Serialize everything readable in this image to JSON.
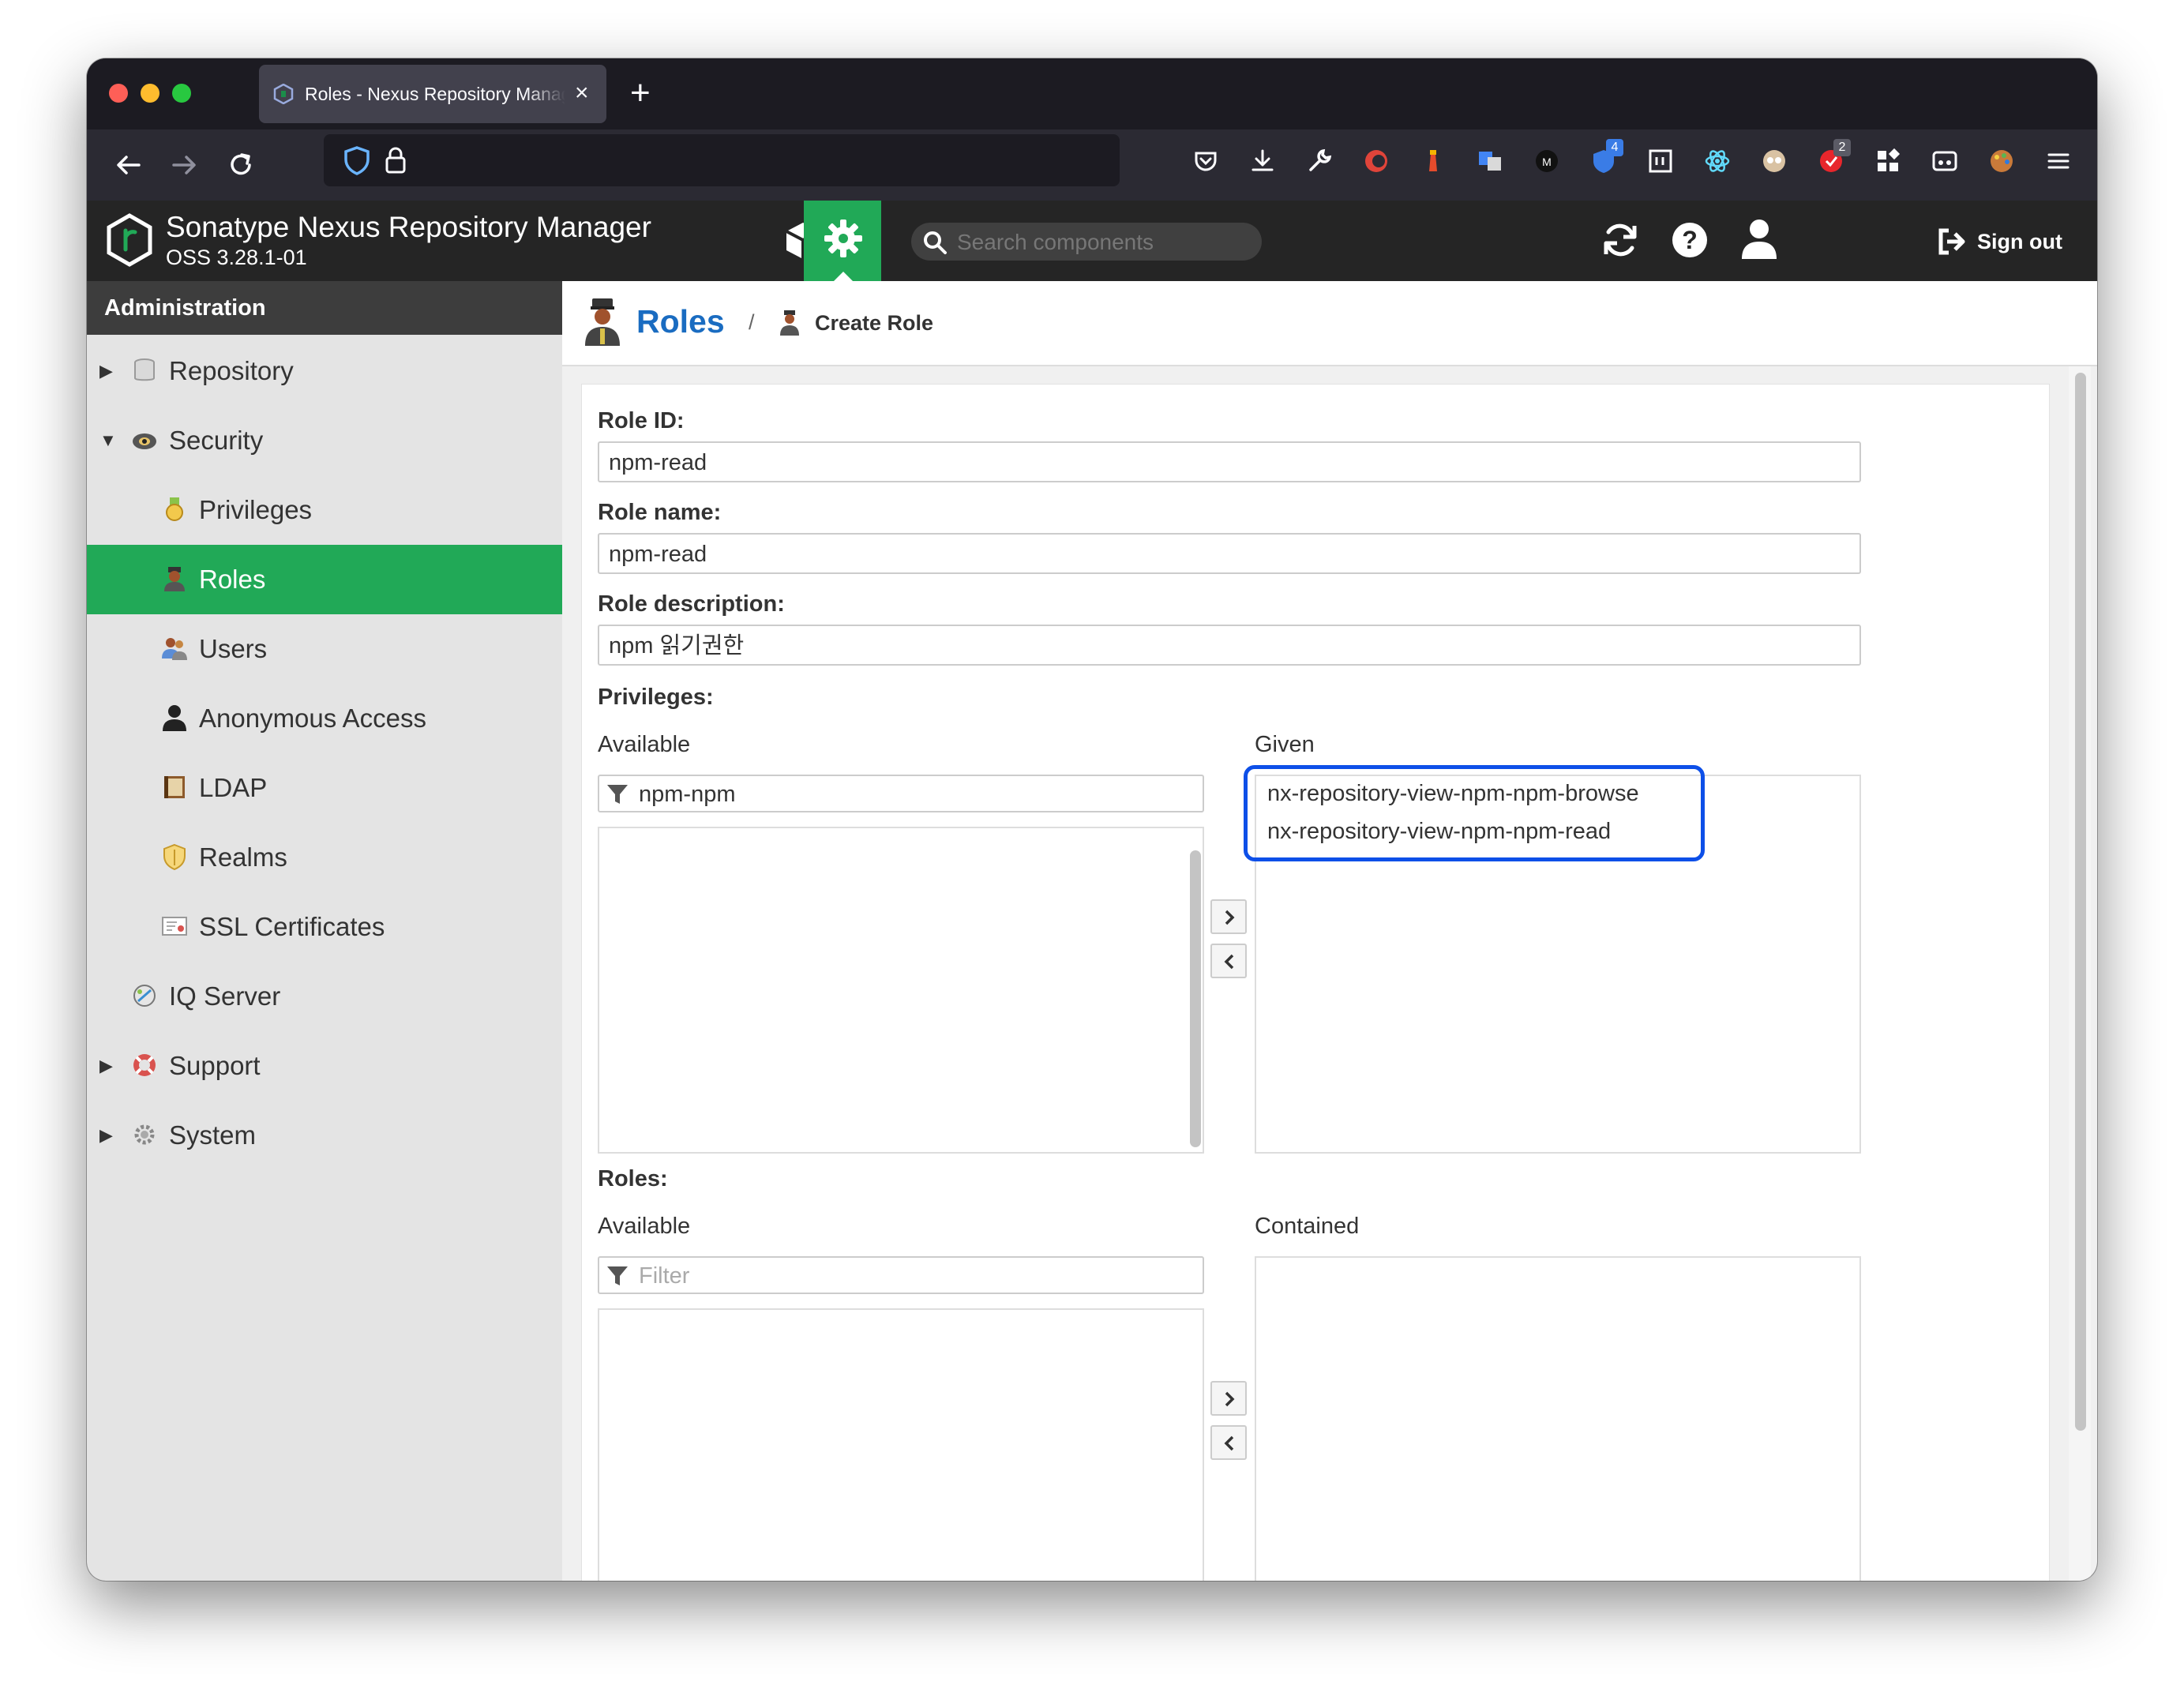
{
  "browser": {
    "tab_title": "Roles - Nexus Repository Manager",
    "tab_close": "×",
    "new_tab": "+",
    "ext_badge_ublock": "4",
    "ext_badge_other": "2"
  },
  "header": {
    "brand_name": "Sonatype Nexus Repository Manager",
    "version": "OSS 3.28.1-01",
    "search_placeholder": "Search components",
    "sign_out": "Sign out"
  },
  "sidebar": {
    "title": "Administration",
    "items": [
      {
        "label": "Repository",
        "icon": "database-icon",
        "expandable": "collapsed"
      },
      {
        "label": "Security",
        "icon": "security-icon",
        "expandable": "expanded"
      },
      {
        "label": "Privileges",
        "icon": "medal-icon"
      },
      {
        "label": "Roles",
        "icon": "role-icon",
        "active": true
      },
      {
        "label": "Users",
        "icon": "users-icon"
      },
      {
        "label": "Anonymous Access",
        "icon": "person-icon"
      },
      {
        "label": "LDAP",
        "icon": "book-icon"
      },
      {
        "label": "Realms",
        "icon": "shield-icon"
      },
      {
        "label": "SSL Certificates",
        "icon": "certificate-icon"
      },
      {
        "label": "IQ Server",
        "icon": "iq-server-icon"
      },
      {
        "label": "Support",
        "icon": "lifebuoy-icon",
        "expandable": "collapsed"
      },
      {
        "label": "System",
        "icon": "gear-icon",
        "expandable": "collapsed"
      }
    ]
  },
  "breadcrumb": {
    "root": "Roles",
    "separator": "/",
    "current": "Create Role"
  },
  "form": {
    "role_id_label": "Role ID:",
    "role_id_value": "npm-read",
    "role_name_label": "Role name:",
    "role_name_value": "npm-read",
    "role_desc_label": "Role description:",
    "role_desc_value": "npm 읽기권한",
    "privileges": {
      "label": "Privileges:",
      "available_label": "Available",
      "filter_value": "npm-npm",
      "given_label": "Given",
      "given": [
        "nx-repository-view-npm-npm-browse",
        "nx-repository-view-npm-npm-read"
      ]
    },
    "roles": {
      "label": "Roles:",
      "available_label": "Available",
      "filter_placeholder": "Filter",
      "contained_label": "Contained"
    }
  },
  "colors": {
    "accent_green": "#21a957",
    "link_blue": "#1a6cc1",
    "highlight_blue": "#0d4fe8"
  }
}
